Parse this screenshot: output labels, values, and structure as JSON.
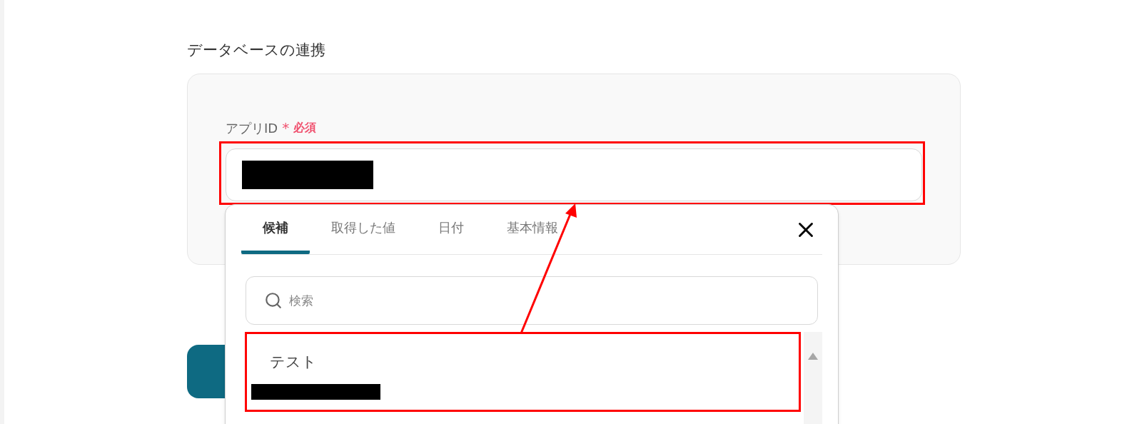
{
  "section_title": "データベースの連携",
  "field": {
    "label": "アプリID",
    "required_mark": "*",
    "required_text": "必須"
  },
  "popup": {
    "tabs": [
      {
        "label": "候補",
        "selected": true
      },
      {
        "label": "取得した値",
        "selected": false
      },
      {
        "label": "日付",
        "selected": false
      },
      {
        "label": "基本情報",
        "selected": false
      }
    ],
    "search": {
      "placeholder": "検索"
    },
    "options": [
      {
        "label": "テスト"
      }
    ]
  }
}
